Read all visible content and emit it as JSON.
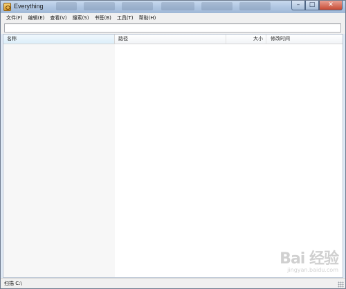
{
  "window": {
    "title": "Everything",
    "minimize_glyph": "–",
    "maximize_glyph": "□",
    "close_glyph": "✕"
  },
  "menu": [
    {
      "label": "文件(F)"
    },
    {
      "label": "编辑(E)"
    },
    {
      "label": "查看(V)"
    },
    {
      "label": "搜索(S)"
    },
    {
      "label": "书签(B)"
    },
    {
      "label": "工具(T)"
    },
    {
      "label": "帮助(H)"
    }
  ],
  "search": {
    "value": "",
    "placeholder": ""
  },
  "columns": {
    "name": "名称",
    "path": "路径",
    "size": "大小",
    "date": "修改时间",
    "sort_indicator": "^"
  },
  "status": {
    "text": "扫描 C:\\"
  },
  "watermark": {
    "logo": "Bai 经验",
    "sub": "jingyan.baidu.com"
  },
  "icons": {
    "app": "everything-app-icon",
    "resize": "resize-grip-icon"
  }
}
